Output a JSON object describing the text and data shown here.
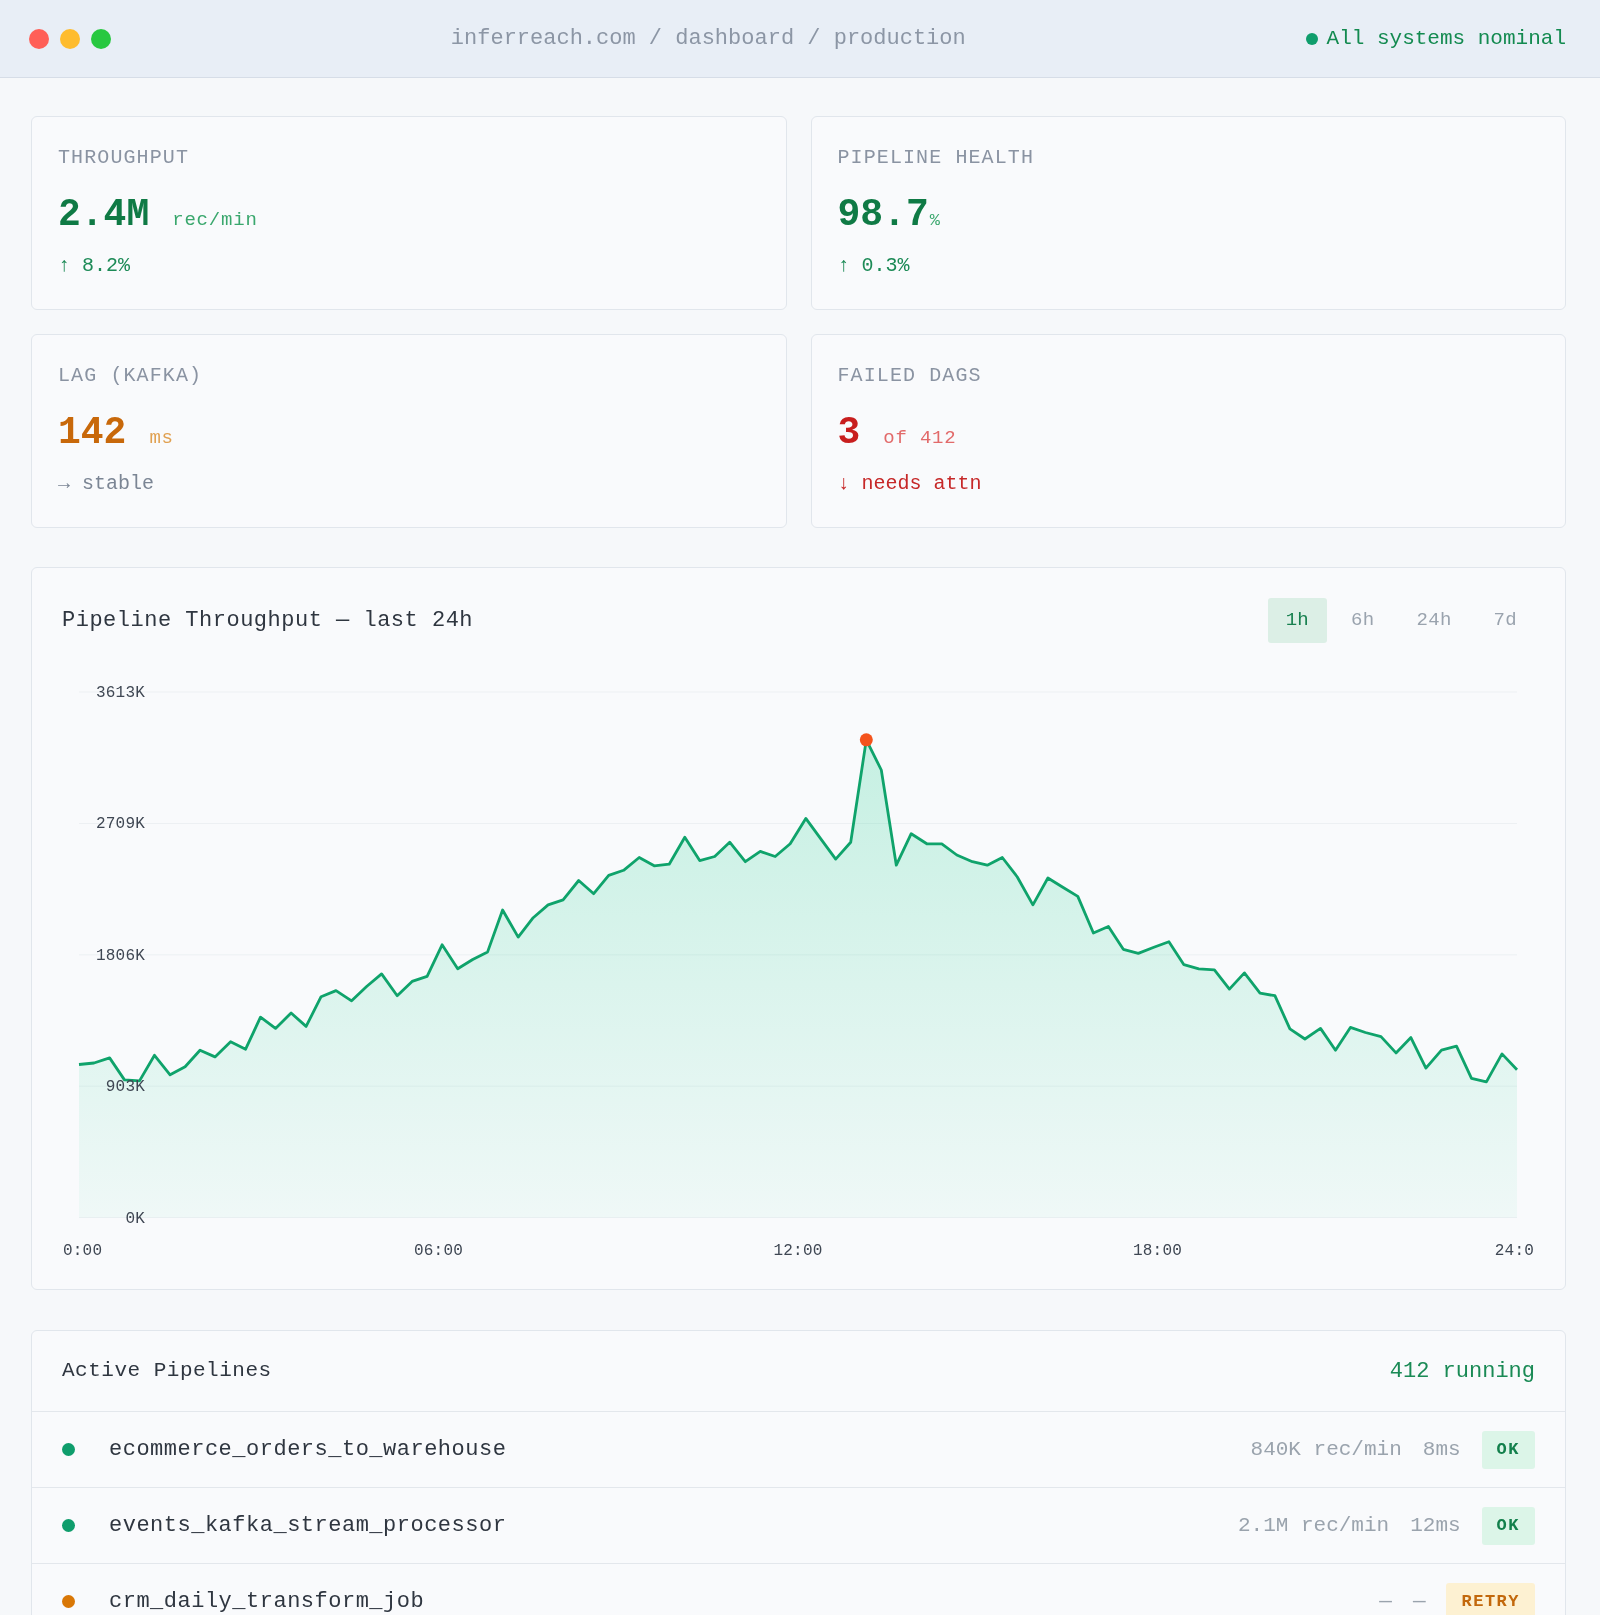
{
  "top_bar": {
    "breadcrumb": "inferreach.com / dashboard / production",
    "system_status": {
      "text": "All systems nominal",
      "kind": "ok"
    }
  },
  "stat_cards": [
    {
      "label": "THROUGHPUT",
      "kind": "good",
      "value": "2.4M",
      "unit": {
        "text": "rec/min",
        "kind": "separate"
      },
      "delta": {
        "text": "↑ 8.2%",
        "kind": "up"
      }
    },
    {
      "label": "PIPELINE HEALTH",
      "kind": "good",
      "value": "98.7",
      "unit": {
        "text": "%",
        "kind": "suffix"
      },
      "delta": {
        "text": "↑ 0.3%",
        "kind": "up"
      }
    },
    {
      "label": "LAG (KAFKA)",
      "kind": "warn",
      "value": "142",
      "unit": {
        "text": "ms",
        "kind": "separate"
      },
      "delta": {
        "text": "→ stable",
        "kind": "flat"
      }
    },
    {
      "label": "FAILED DAGS",
      "kind": "bad",
      "value": "3",
      "unit": {
        "text": "of 412",
        "kind": "separate"
      },
      "delta": {
        "text": "↓ needs attn",
        "kind": "down"
      }
    }
  ],
  "chart_panel": {
    "range_tabs": [
      {
        "label": "1h",
        "selected": true
      },
      {
        "label": "6h",
        "selected": false
      },
      {
        "label": "24h",
        "selected": false
      },
      {
        "label": "7d",
        "selected": false
      }
    ],
    "chart_data": {
      "type": "area",
      "title": "Pipeline Throughput — last 24h",
      "grid": true,
      "xlim": [
        0,
        24
      ],
      "ylim": [
        0,
        3613
      ],
      "xticks": [
        {
          "value": 0,
          "label": "0:00"
        },
        {
          "value": 6,
          "label": "06:00"
        },
        {
          "value": 12,
          "label": "12:00"
        },
        {
          "value": 18,
          "label": "18:00"
        },
        {
          "value": 24,
          "label": "24:0"
        }
      ],
      "yticks": [
        {
          "value": 0,
          "label": "0K"
        },
        {
          "value": 903,
          "label": "903K"
        },
        {
          "value": 1806,
          "label": "1806K"
        },
        {
          "value": 2709,
          "label": "2709K"
        },
        {
          "value": 3613,
          "label": "3613K"
        }
      ],
      "x": [
        0,
        0.25,
        0.51,
        0.76,
        1.01,
        1.26,
        1.52,
        1.77,
        2.02,
        2.27,
        2.53,
        2.78,
        3.03,
        3.28,
        3.54,
        3.79,
        4.04,
        4.29,
        4.55,
        4.8,
        5.05,
        5.31,
        5.56,
        5.81,
        6.06,
        6.32,
        6.57,
        6.82,
        7.07,
        7.33,
        7.58,
        7.83,
        8.08,
        8.34,
        8.59,
        8.84,
        9.09,
        9.35,
        9.6,
        9.85,
        10.11,
        10.36,
        10.61,
        10.86,
        11.12,
        11.37,
        11.62,
        11.87,
        12.13,
        12.38,
        12.63,
        12.88,
        13.14,
        13.39,
        13.64,
        13.89,
        14.15,
        14.4,
        14.65,
        14.91,
        15.16,
        15.41,
        15.66,
        15.92,
        16.17,
        16.42,
        16.67,
        16.93,
        17.18,
        17.43,
        17.68,
        17.94,
        18.19,
        18.44,
        18.69,
        18.95,
        19.2,
        19.45,
        19.71,
        19.96,
        20.21,
        20.46,
        20.72,
        20.97,
        21.22,
        21.47,
        21.73,
        21.98,
        22.23,
        22.48,
        22.74,
        22.99,
        23.24,
        23.49,
        23.75,
        24
      ],
      "values": [
        1052,
        1062,
        1097,
        946,
        939,
        1115,
        981,
        1037,
        1150,
        1104,
        1209,
        1157,
        1377,
        1300,
        1406,
        1314,
        1518,
        1560,
        1490,
        1588,
        1675,
        1525,
        1623,
        1658,
        1875,
        1710,
        1774,
        1826,
        2114,
        1928,
        2061,
        2149,
        2184,
        2317,
        2226,
        2352,
        2387,
        2475,
        2418,
        2429,
        2615,
        2454,
        2482,
        2580,
        2446,
        2517,
        2482,
        2569,
        2744,
        2604,
        2464,
        2580,
        3284,
        3077,
        2422,
        2639,
        2569,
        2569,
        2492,
        2446,
        2422,
        2475,
        2341,
        2149,
        2334,
        2271,
        2208,
        1956,
        2001,
        1844,
        1816,
        1858,
        1896,
        1738,
        1710,
        1703,
        1570,
        1682,
        1542,
        1525,
        1297,
        1227,
        1300,
        1150,
        1307,
        1272,
        1244,
        1132,
        1237,
        1027,
        1150,
        1178,
        957,
        932,
        1125,
        1016
      ]
    }
  },
  "pipelines": {
    "title": "Active Pipelines",
    "summary": "412 running",
    "rows": [
      {
        "name": "ecommerce_orders_to_warehouse",
        "throughput": "840K rec/min",
        "latency": "8ms",
        "status": "OK",
        "kind": "ok",
        "color": "#0f9d6c"
      },
      {
        "name": "events_kafka_stream_processor",
        "throughput": "2.1M rec/min",
        "latency": "12ms",
        "status": "OK",
        "kind": "ok",
        "color": "#0f9d6c"
      },
      {
        "name": "crm_daily_transform_job",
        "throughput": "—",
        "latency": "—",
        "status": "RETRY",
        "kind": "retry",
        "color": "#d97706"
      }
    ]
  }
}
